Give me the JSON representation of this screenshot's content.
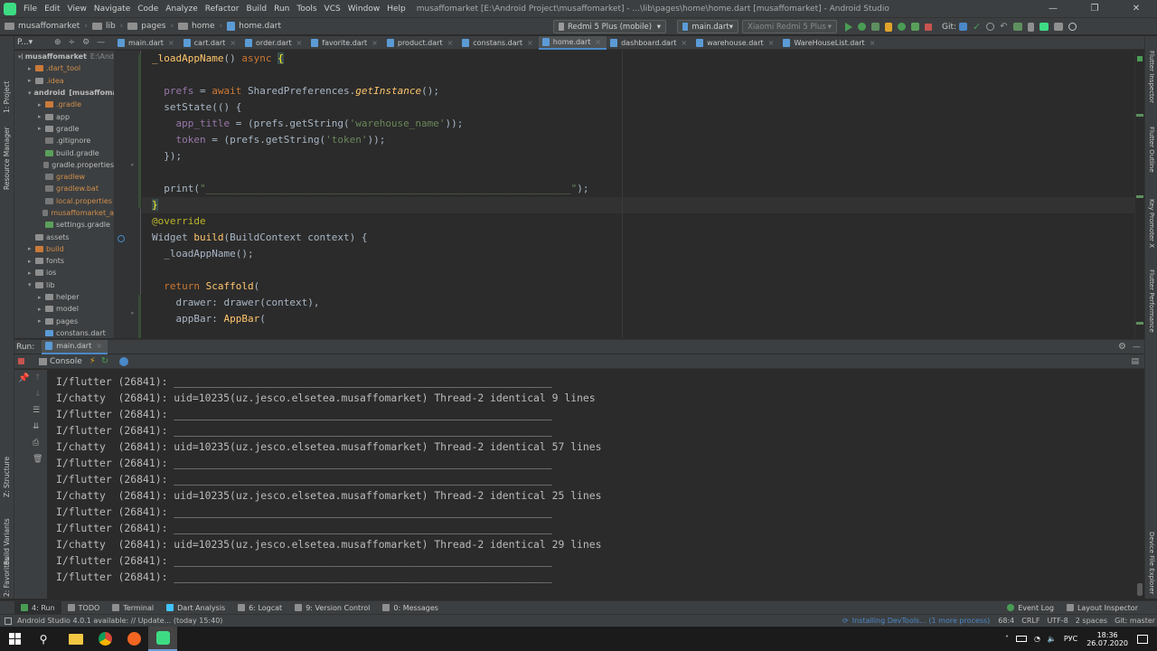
{
  "titlebar": {
    "menu": [
      "File",
      "Edit",
      "View",
      "Navigate",
      "Code",
      "Analyze",
      "Refactor",
      "Build",
      "Run",
      "Tools",
      "VCS",
      "Window",
      "Help"
    ],
    "title": "musaffomarket [E:\\Android Project\\musaffomarket] - ...\\lib\\pages\\home\\home.dart [musaffomarket] - Android Studio",
    "minimize": "—",
    "maximize": "❐",
    "close": "✕"
  },
  "navbar": {
    "breadcrumbs": [
      "musaffomarket",
      "lib",
      "pages",
      "home",
      "home.dart"
    ],
    "device": "Redmi 5 Plus (mobile)",
    "run_config": "main.dart",
    "device2": "Xiaomi Redmi 5 Plus",
    "git_label": "Git:"
  },
  "left_strip": [
    "1: Project",
    "Resource Manager",
    "Z: Structure",
    "Build Variants",
    "2: Favorites"
  ],
  "right_strip": [
    "Flutter Inspector",
    "Flutter Outline",
    "Key Promoter X",
    "Flutter Performance",
    "Device File Explorer"
  ],
  "project": {
    "view_label": "P...▾",
    "tree": [
      {
        "depth": 0,
        "arrow": "▾",
        "label": "musaffomarket",
        "suffix": "E:\\And",
        "color": "#bbbbbb",
        "bold": true,
        "icon": "#8f8f8f"
      },
      {
        "depth": 1,
        "arrow": "▸",
        "label": ".dart_tool",
        "color": "#d08e4b",
        "icon": "#c97a3a"
      },
      {
        "depth": 1,
        "arrow": "▸",
        "label": ".idea",
        "color": "#d08e4b",
        "icon": "#8f8f8f"
      },
      {
        "depth": 1,
        "arrow": "▾",
        "label": "android",
        "suffix": "[musaffoma",
        "color": "#bbbbbb",
        "bold": true,
        "icon": "#8f8f8f"
      },
      {
        "depth": 2,
        "arrow": "▸",
        "label": ".gradle",
        "color": "#d08e4b",
        "icon": "#c97a3a"
      },
      {
        "depth": 2,
        "arrow": "▸",
        "label": "app",
        "color": "#bbbbbb",
        "icon": "#8f8f8f"
      },
      {
        "depth": 2,
        "arrow": "▸",
        "label": "gradle",
        "color": "#bbbbbb",
        "icon": "#8f8f8f"
      },
      {
        "depth": 2,
        "arrow": "",
        "label": ".gitignore",
        "color": "#bbbbbb",
        "icon": "#777777"
      },
      {
        "depth": 2,
        "arrow": "",
        "label": "build.gradle",
        "color": "#bbbbbb",
        "icon": "#5aa05a"
      },
      {
        "depth": 2,
        "arrow": "",
        "label": "gradle.properties",
        "color": "#bbbbbb",
        "icon": "#777777"
      },
      {
        "depth": 2,
        "arrow": "",
        "label": "gradlew",
        "color": "#d08e4b",
        "icon": "#777777"
      },
      {
        "depth": 2,
        "arrow": "",
        "label": "gradlew.bat",
        "color": "#d08e4b",
        "icon": "#777777"
      },
      {
        "depth": 2,
        "arrow": "",
        "label": "local.properties",
        "color": "#d08e4b",
        "icon": "#777777"
      },
      {
        "depth": 2,
        "arrow": "",
        "label": "musaffomarket_a",
        "color": "#d08e4b",
        "icon": "#777777"
      },
      {
        "depth": 2,
        "arrow": "",
        "label": "settings.gradle",
        "color": "#bbbbbb",
        "icon": "#5aa05a"
      },
      {
        "depth": 1,
        "arrow": "",
        "label": "assets",
        "color": "#bbbbbb",
        "icon": "#8f8f8f"
      },
      {
        "depth": 1,
        "arrow": "▸",
        "label": "build",
        "color": "#d08e4b",
        "icon": "#c97a3a"
      },
      {
        "depth": 1,
        "arrow": "▸",
        "label": "fonts",
        "color": "#bbbbbb",
        "icon": "#8f8f8f"
      },
      {
        "depth": 1,
        "arrow": "▸",
        "label": "ios",
        "color": "#bbbbbb",
        "icon": "#8f8f8f"
      },
      {
        "depth": 1,
        "arrow": "▾",
        "label": "lib",
        "color": "#bbbbbb",
        "icon": "#8f8f8f"
      },
      {
        "depth": 2,
        "arrow": "▸",
        "label": "helper",
        "color": "#bbbbbb",
        "icon": "#8f8f8f"
      },
      {
        "depth": 2,
        "arrow": "▸",
        "label": "model",
        "color": "#bbbbbb",
        "icon": "#8f8f8f"
      },
      {
        "depth": 2,
        "arrow": "▸",
        "label": "pages",
        "color": "#bbbbbb",
        "icon": "#8f8f8f"
      },
      {
        "depth": 2,
        "arrow": "",
        "label": "constans.dart",
        "color": "#bbbbbb",
        "icon": "#5b9bd5"
      }
    ]
  },
  "tabs": [
    "main.dart",
    "cart.dart",
    "order.dart",
    "favorite.dart",
    "product.dart",
    "constans.dart",
    "home.dart",
    "dashboard.dart",
    "warehouse.dart",
    "WareHouseList.dart"
  ],
  "active_tab": "home.dart",
  "code": {
    "fn_name": "_loadAppName",
    "async_kw": "async",
    "open_brace": "{",
    "prefs_var": "prefs",
    "await_kw": "await",
    "shared_prefs": "SharedPreferences",
    "get_instance": "getInstance",
    "set_state": "setState",
    "app_title": "app_title",
    "token": "token",
    "get_string": "prefs.getString",
    "warehouse_key": "'warehouse_name'",
    "token_key": "'token'",
    "print_fn": "print",
    "print_str": "\"_____________________________________________________________\"",
    "close_brace": "}",
    "override": "@override",
    "widget": "Widget",
    "build": "build",
    "build_ctx": "BuildContext context",
    "return_kw": "return",
    "scaffold": "Scaffold",
    "drawer_prop": "drawer",
    "drawer_call": "drawer(context),",
    "appbar_prop": "appBar",
    "appbar_cls": "AppBar"
  },
  "run": {
    "label": "Run:",
    "config": "main.dart",
    "console_tab": "Console"
  },
  "console_lines": [
    "I/flutter (26841): _____________________________________________________________",
    "I/chatty  (26841): uid=10235(uz.jesco.elsetea.musaffomarket) Thread-2 identical 9 lines",
    "I/flutter (26841): _____________________________________________________________",
    "I/flutter (26841): _____________________________________________________________",
    "I/chatty  (26841): uid=10235(uz.jesco.elsetea.musaffomarket) Thread-2 identical 57 lines",
    "I/flutter (26841): _____________________________________________________________",
    "I/flutter (26841): _____________________________________________________________",
    "I/chatty  (26841): uid=10235(uz.jesco.elsetea.musaffomarket) Thread-2 identical 25 lines",
    "I/flutter (26841): _____________________________________________________________",
    "I/flutter (26841): _____________________________________________________________",
    "I/chatty  (26841): uid=10235(uz.jesco.elsetea.musaffomarket) Thread-2 identical 29 lines",
    "I/flutter (26841): _____________________________________________________________",
    "I/flutter (26841): _____________________________________________________________"
  ],
  "bottom_tabs": [
    "4: Run",
    "TODO",
    "Terminal",
    "Dart Analysis",
    "6: Logcat",
    "9: Version Control",
    "0: Messages"
  ],
  "bottom_right": [
    "Event Log",
    "Layout Inspector"
  ],
  "status": {
    "left": "Android Studio 4.0.1 available: // Update... (today 15:40)",
    "installing": "Installing DevTools... (1 more process)",
    "position": "68:4",
    "line_sep": "CRLF",
    "encoding": "UTF-8",
    "indent": "2 spaces",
    "git": "Git: master"
  },
  "taskbar": {
    "lang": "РУС",
    "time": "18:36",
    "date": "26.07.2020"
  },
  "colors": {
    "accent": "#4a88c7",
    "run_green": "#499c54",
    "stop_red": "#c75450"
  }
}
